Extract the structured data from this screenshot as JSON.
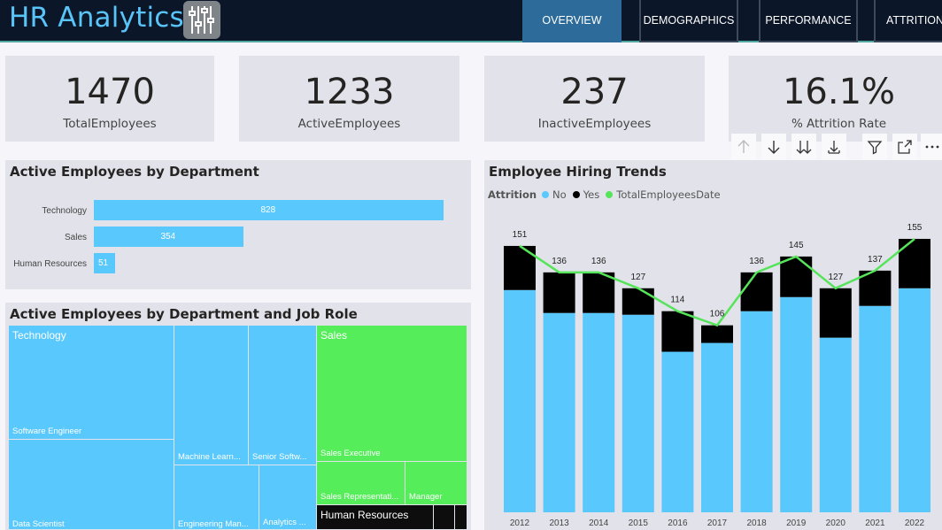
{
  "header": {
    "title": "HR Analytics",
    "logo_icon": "sliders-icon",
    "nav": [
      {
        "label": "OVERVIEW",
        "active": true
      },
      {
        "label": "DEMOGRAPHICS",
        "active": false
      },
      {
        "label": "PERFORMANCE",
        "active": false
      },
      {
        "label": "ATTRITION",
        "active": false
      }
    ]
  },
  "kpis": [
    {
      "value": "1470",
      "label": "TotalEmployees"
    },
    {
      "value": "1233",
      "label": "ActiveEmployees"
    },
    {
      "value": "237",
      "label": "InactiveEmployees"
    },
    {
      "value": "16.1%",
      "label": "% Attrition Rate"
    }
  ],
  "dept_chart": {
    "title": "Active Employees by Department",
    "chart_data": {
      "type": "bar",
      "orientation": "horizontal",
      "categories": [
        "Technology",
        "Sales",
        "Human Resources"
      ],
      "values": [
        828,
        354,
        51
      ],
      "color": "#59c8fc"
    }
  },
  "treemap": {
    "title": "Active Employees by Department and Job Role",
    "groups": {
      "technology": "Technology",
      "sales": "Sales",
      "hr": "Human Resources"
    },
    "roles": {
      "software_engineer": "Software Engineer",
      "data_scientist": "Data Scientist",
      "machine_learning": "Machine Learn...",
      "engineering_manager": "Engineering Man...",
      "senior_software": "Senior Softw...",
      "analytics": "Analytics ...",
      "sales_executive": "Sales Executive",
      "sales_representative": "Sales Representati...",
      "manager": "Manager"
    },
    "colors": {
      "technology": "#59c8fc",
      "sales": "#55ee5a",
      "hr": "#0d0d0d"
    }
  },
  "toolbar": {
    "icons": [
      "arrow-up-icon",
      "arrow-down-icon",
      "double-arrow-down-icon",
      "expand-hierarchy-icon",
      "filter-icon",
      "focus-mode-icon",
      "more-options-icon"
    ]
  },
  "hiring_chart": {
    "title": "Employee Hiring Trends",
    "legend_title": "Attrition",
    "legend": [
      {
        "name": "No",
        "color": "#59c8fc"
      },
      {
        "name": "Yes",
        "color": "#000000"
      },
      {
        "name": "TotalEmployeesDate",
        "color": "#55e45a"
      }
    ],
    "chart_data": {
      "type": "bar",
      "stacked": true,
      "categories": [
        "2012",
        "2013",
        "2014",
        "2015",
        "2016",
        "2017",
        "2018",
        "2019",
        "2020",
        "2021",
        "2022"
      ],
      "series": [
        {
          "name": "No",
          "values": [
            126,
            113,
            113,
            112,
            91,
            96,
            114,
            122,
            99,
            117,
            127
          ]
        },
        {
          "name": "Yes",
          "values": [
            25,
            23,
            23,
            15,
            23,
            10,
            22,
            23,
            28,
            20,
            28
          ]
        }
      ],
      "line": {
        "name": "TotalEmployeesDate",
        "values": [
          151,
          136,
          136,
          127,
          114,
          106,
          136,
          145,
          127,
          137,
          155
        ]
      },
      "data_labels": [
        151,
        136,
        136,
        127,
        114,
        106,
        136,
        145,
        127,
        137,
        155
      ],
      "ylim": [
        0,
        160
      ]
    }
  }
}
